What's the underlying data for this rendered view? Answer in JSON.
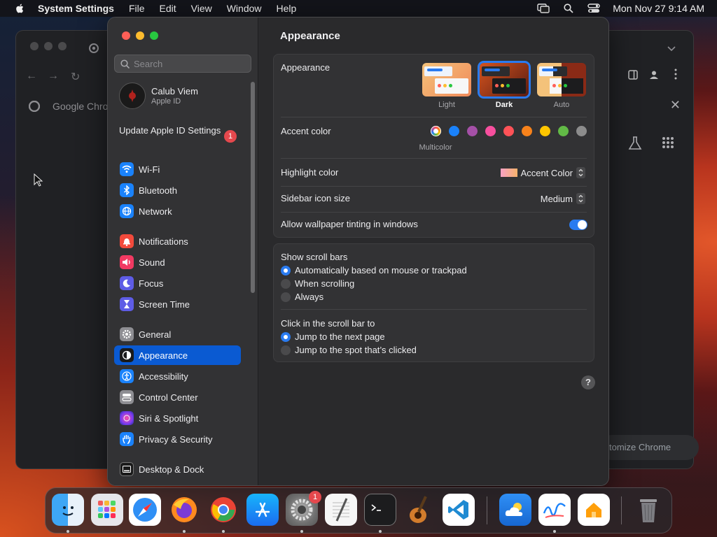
{
  "menubar": {
    "app_name": "System Settings",
    "menus": [
      "File",
      "Edit",
      "View",
      "Window",
      "Help"
    ],
    "clock": "Mon Nov 27  9:14 AM"
  },
  "chrome": {
    "tab_title": "Google Chro",
    "customize_label": "tomize Chrome"
  },
  "sidebar": {
    "search_placeholder": "Search",
    "account": {
      "name": "Calub Viem",
      "subtitle": "Apple ID"
    },
    "update": {
      "label": "Update Apple ID Settings",
      "badge": "1"
    },
    "items": [
      {
        "label": "Wi-Fi",
        "icon": "wifi-icon",
        "color": "#1a82fb"
      },
      {
        "label": "Bluetooth",
        "icon": "bluetooth-icon",
        "color": "#1a82fb"
      },
      {
        "label": "Network",
        "icon": "globe-icon",
        "color": "#1a82fb"
      },
      {
        "label": "Notifications",
        "icon": "bell-icon",
        "color": "#f24a3c"
      },
      {
        "label": "Sound",
        "icon": "speaker-icon",
        "color": "#f23a62"
      },
      {
        "label": "Focus",
        "icon": "moon-icon",
        "color": "#5e5ce6"
      },
      {
        "label": "Screen Time",
        "icon": "hourglass-icon",
        "color": "#5e5ce6"
      },
      {
        "label": "General",
        "icon": "gear-icon",
        "color": "#8e8e93"
      },
      {
        "label": "Appearance",
        "icon": "appearance-icon",
        "color": "#1a1a1a"
      },
      {
        "label": "Accessibility",
        "icon": "accessibility-icon",
        "color": "#1a82fb"
      },
      {
        "label": "Control Center",
        "icon": "control-center-icon",
        "color": "#8e8e93"
      },
      {
        "label": "Siri & Spotlight",
        "icon": "siri-icon",
        "color": "#b03fd0"
      },
      {
        "label": "Privacy & Security",
        "icon": "hand-icon",
        "color": "#1a82fb"
      },
      {
        "label": "Desktop & Dock",
        "icon": "dock-icon",
        "color": "#1a1a1a"
      }
    ],
    "selected": "Appearance"
  },
  "content": {
    "title": "Appearance",
    "appearance": {
      "label": "Appearance",
      "options": [
        "Light",
        "Dark",
        "Auto"
      ],
      "selected": "Dark"
    },
    "accent": {
      "label": "Accent color",
      "caption": "Multicolor",
      "colors": [
        "multicolor",
        "#1a82fb",
        "#a550a7",
        "#f74f9e",
        "#ff5257",
        "#f7821b",
        "#ffc600",
        "#62ba46",
        "#8c8c8c"
      ]
    },
    "highlight": {
      "label": "Highlight color",
      "value": "Accent Color"
    },
    "sidebar_icon_size": {
      "label": "Sidebar icon size",
      "value": "Medium"
    },
    "wallpaper_tinting": {
      "label": "Allow wallpaper tinting in windows",
      "on": true
    },
    "scroll_bars": {
      "label": "Show scroll bars",
      "options": [
        "Automatically based on mouse or trackpad",
        "When scrolling",
        "Always"
      ],
      "selected": 0
    },
    "click_scroll": {
      "label": "Click in the scroll bar to",
      "options": [
        "Jump to the next page",
        "Jump to the spot that’s clicked"
      ],
      "selected": 0
    },
    "help": "?"
  },
  "dock": {
    "apps": [
      "finder-icon",
      "launchpad-icon",
      "safari-icon",
      "firefox-icon",
      "chrome-icon",
      "app-store-icon",
      "system-settings-icon",
      "textedit-icon",
      "terminal-icon",
      "garageband-icon",
      "vscode-icon",
      "weather-icon",
      "freeform-icon",
      "home-icon",
      "trash-icon"
    ],
    "settings_badge": "1"
  }
}
